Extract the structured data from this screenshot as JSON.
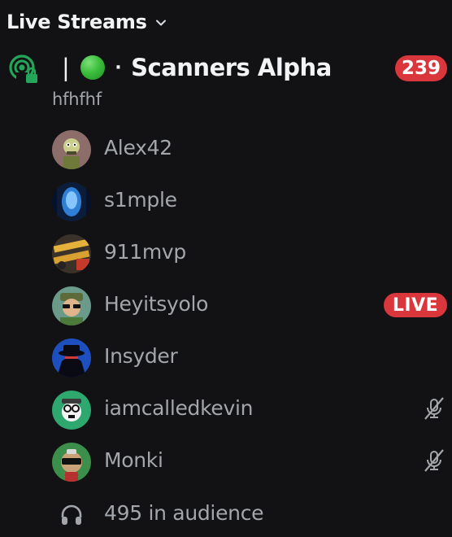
{
  "section": {
    "title": "Live Streams",
    "chevron_icon": "chevron-down-icon"
  },
  "channel": {
    "icon": "stage-channel-icon",
    "pipe": "|",
    "status_emoji": "green-circle",
    "separator": "·",
    "name": "Scanners Alpha",
    "count": "239",
    "topic": "hfhfhf"
  },
  "users": [
    {
      "name": "Alex42",
      "avatar": "alex42-avatar",
      "live": false,
      "muted": false
    },
    {
      "name": "s1mple",
      "avatar": "s1mple-avatar",
      "live": false,
      "muted": false
    },
    {
      "name": "911mvp",
      "avatar": "911mvp-avatar",
      "live": false,
      "muted": false
    },
    {
      "name": "Heyitsyolo",
      "avatar": "heyitsyolo-avatar",
      "live": true,
      "muted": false
    },
    {
      "name": "Insyder",
      "avatar": "insyder-avatar",
      "live": false,
      "muted": false
    },
    {
      "name": "iamcalledkevin",
      "avatar": "iamcalledkevin-avatar",
      "live": false,
      "muted": true
    },
    {
      "name": "Monki",
      "avatar": "monki-avatar",
      "live": false,
      "muted": true
    }
  ],
  "live_label": "LIVE",
  "audience": {
    "icon": "headphones-icon",
    "text": "495 in audience"
  },
  "colors": {
    "background": "#121214",
    "badge_red": "#da373c",
    "stage_green": "#23a55a",
    "text_primary": "#f2f3f5",
    "text_muted": "#a3a6aa"
  }
}
